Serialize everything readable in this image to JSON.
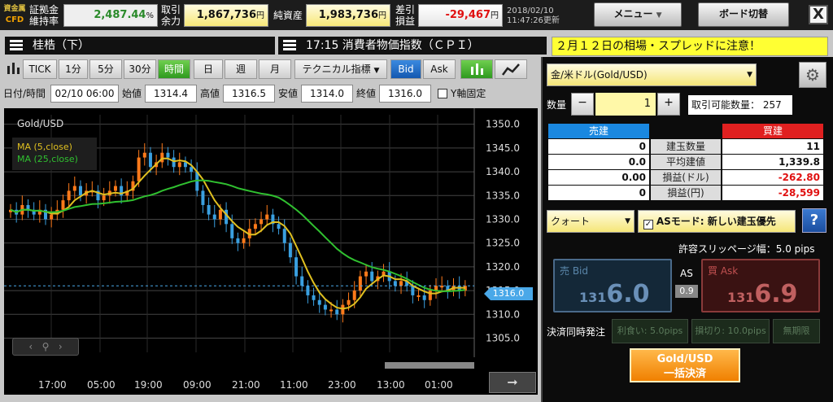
{
  "logo": {
    "line1": "資金属",
    "line2": "CFD"
  },
  "top": {
    "margin_label1": "証拠金",
    "margin_label2": "維持率",
    "margin_value": "2,487.44",
    "margin_unit": "%",
    "avail_label1": "取引",
    "avail_label2": "余力",
    "avail_value": "1,867,736",
    "avail_unit": "円",
    "net_label": "純資産",
    "net_value": "1,983,736",
    "net_unit": "円",
    "pl_label1": "差引",
    "pl_label2": "損益",
    "pl_value": "-29,467",
    "pl_unit": "円",
    "date": "2018/02/10",
    "time": "11:47:26更新",
    "menu_label": "メニュー",
    "board_label": "ボード切替",
    "close_label": "X"
  },
  "header": {
    "instrument": "桂梏（下）",
    "news": "17:15 消費者物価指数（ＣＰＩ）",
    "warning": "２月１２日の相場・スプレッドに注意！"
  },
  "toolbar": {
    "tick": "TICK",
    "m1": "1分",
    "m5": "5分",
    "m30": "30分",
    "hour": "時間",
    "day": "日",
    "week": "週",
    "month": "月",
    "tech": "テクニカル指標",
    "bid": "Bid",
    "ask": "Ask"
  },
  "ohlc": {
    "dt_label": "日付/時間",
    "dt_value": "02/10 06:00",
    "open_label": "始値",
    "open_value": "1314.4",
    "high_label": "高値",
    "high_value": "1316.5",
    "low_label": "安値",
    "low_value": "1314.0",
    "close_label": "終値",
    "close_value": "1316.0",
    "yfix_label": "Y軸固定"
  },
  "chart_data": {
    "type": "candlestick",
    "title": "Gold/USD",
    "legend": [
      "MA (5,close)",
      "MA (25,close)"
    ],
    "ylim": [
      1302,
      1352
    ],
    "yticks": [
      1305.0,
      1310.0,
      1315.0,
      1320.0,
      1325.0,
      1330.0,
      1335.0,
      1340.0,
      1345.0,
      1350.0
    ],
    "xticks": [
      "17:00",
      "05:00",
      "19:00",
      "09:00",
      "21:00",
      "11:00",
      "23:00",
      "13:00",
      "01:00"
    ],
    "current_price": "1316.0",
    "colors": {
      "up": "#ff7a1a",
      "down": "#3aa0e0",
      "ma5": "#e0c020",
      "ma25": "#30c030"
    },
    "closes": [
      1332,
      1331,
      1333,
      1332,
      1331,
      1332,
      1330,
      1331,
      1332,
      1334,
      1336,
      1337,
      1335,
      1336,
      1336,
      1334,
      1335,
      1336,
      1337,
      1335,
      1336,
      1338,
      1343,
      1344,
      1341,
      1342,
      1344,
      1343,
      1341,
      1342,
      1341,
      1340,
      1336,
      1333,
      1331,
      1330,
      1332,
      1329,
      1326,
      1325,
      1326,
      1328,
      1329,
      1330,
      1331,
      1329,
      1328,
      1325,
      1322,
      1318,
      1316,
      1314,
      1313,
      1312,
      1311,
      1311,
      1310,
      1312,
      1313,
      1315,
      1318,
      1319,
      1317,
      1318,
      1319,
      1317,
      1316,
      1317,
      1316,
      1314,
      1314,
      1313,
      1315,
      1316,
      1316,
      1315,
      1316,
      1315,
      1316
    ]
  },
  "right": {
    "symbol": "金/米ドル(Gold/USD)",
    "qty_label": "数量",
    "qty_value": "1",
    "minus": "−",
    "plus": "+",
    "tradable_label": "取引可能数量：",
    "tradable_value": "257",
    "sell_hdr": "売建",
    "buy_hdr": "買建",
    "rows": [
      {
        "left": "0",
        "label": "建玉数量",
        "right": "11"
      },
      {
        "left": "0.0",
        "label": "平均建値",
        "right": "1,339.8"
      },
      {
        "left": "0.00",
        "label": "損益(ドル)",
        "right": "-262.80"
      },
      {
        "left": "0",
        "label": "損益(円)",
        "right": "-28,599"
      }
    ],
    "order_type": "クォート",
    "as_mode": "ASモード: 新しい建玉優先",
    "help": "?",
    "slip_label": "許容スリッページ幅：5.0  pips",
    "bid_label": "売 Bid",
    "bid_small": "131",
    "bid_big": "6.0",
    "ask_label": "買 Ask",
    "ask_small": "131",
    "ask_big": "6.9",
    "as_label": "AS",
    "spread": "0.9",
    "simul_label": "決済同時発注",
    "rikaku": "利食い: 5.0pips",
    "songiri": "損切り: 10.0pips",
    "mukigen": "無期限",
    "settle_line1": "Gold/USD",
    "settle_line2": "一括決済"
  }
}
